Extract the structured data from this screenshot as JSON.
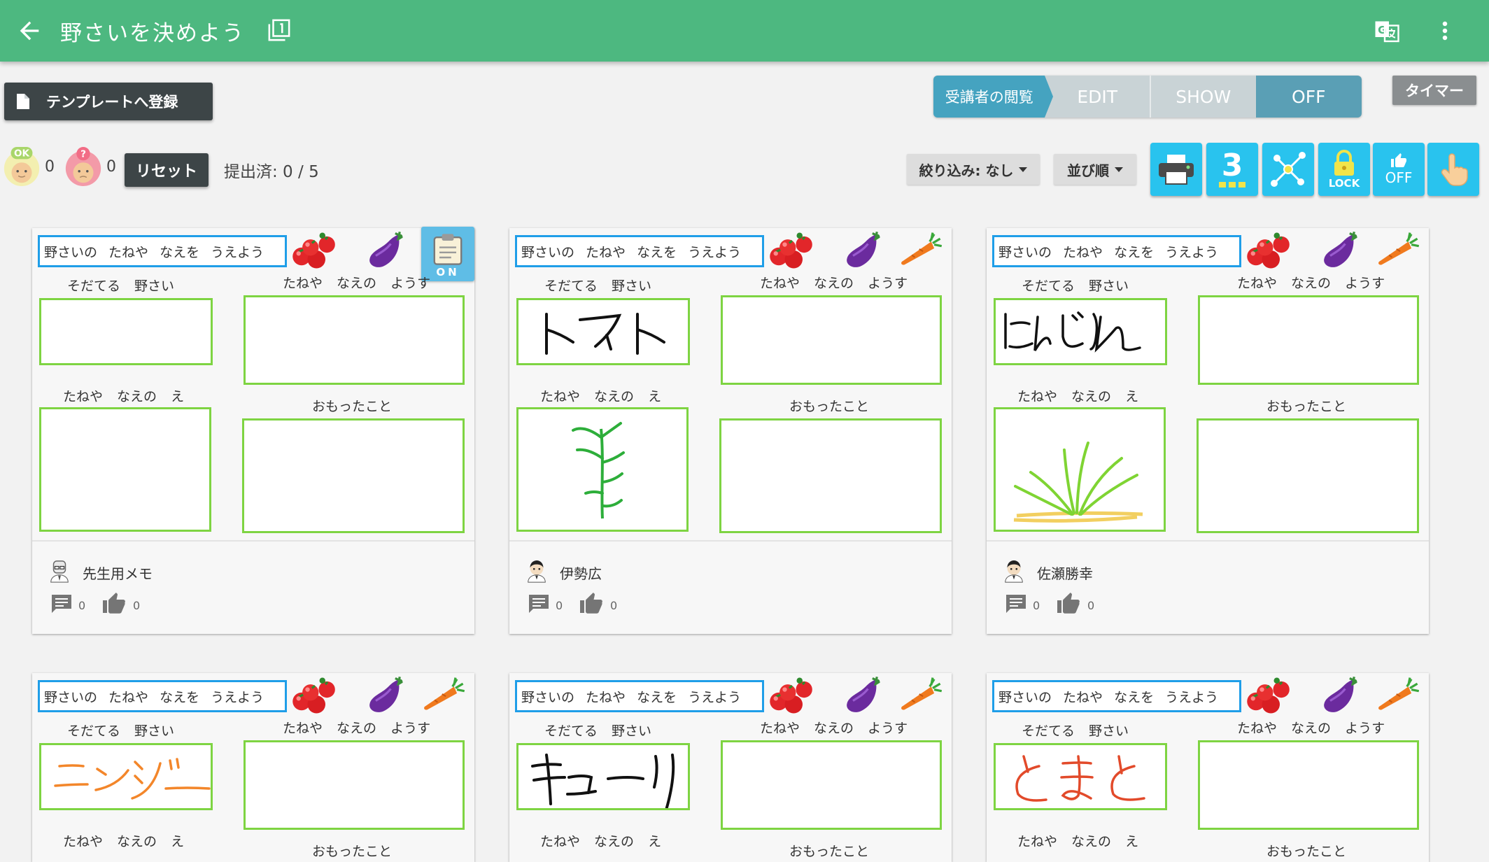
{
  "appbar": {
    "title": "野さいを決めよう",
    "color": "#4db880"
  },
  "toolbar": {
    "template_label": "テンプレートへ登録",
    "viewer_label": "受講者の閲覧",
    "modes": [
      "EDIT",
      "SHOW",
      "OFF"
    ],
    "timer_label": "タイマー",
    "ok_count": "0",
    "question_count": "0",
    "reset_label": "リセット",
    "submitted": "提出済: 0 / 5",
    "filter_label": "絞り込み: なし",
    "sort_label": "並び順",
    "columns_number": "3",
    "lock_label": "LOCK",
    "like_label": "OFF"
  },
  "card_text": {
    "header": "野さいの たねや なえを うえよう",
    "grow_label": "そだてる 野さい",
    "state_label": "たねや なえの ようす",
    "picture_label": "たねや なえの え",
    "thought_label": "おもったこと",
    "on_badge": "ON"
  },
  "cards": [
    {
      "name": "先生用メモ",
      "comments": "0",
      "likes": "0",
      "handwriting": ""
    },
    {
      "name": "伊勢広",
      "comments": "0",
      "likes": "0",
      "handwriting": "トマト"
    },
    {
      "name": "佐瀬勝幸",
      "comments": "0",
      "likes": "0",
      "handwriting": "にんじん"
    },
    {
      "name": "",
      "comments": "",
      "likes": "",
      "handwriting": "ニンジン"
    },
    {
      "name": "",
      "comments": "",
      "likes": "",
      "handwriting": "キュウリ"
    },
    {
      "name": "",
      "comments": "",
      "likes": "",
      "handwriting": "とまと"
    }
  ],
  "colors": {
    "accent_blue": "#29c3ee",
    "box_green": "#7ed442",
    "header_blue": "#1f9ee8"
  }
}
